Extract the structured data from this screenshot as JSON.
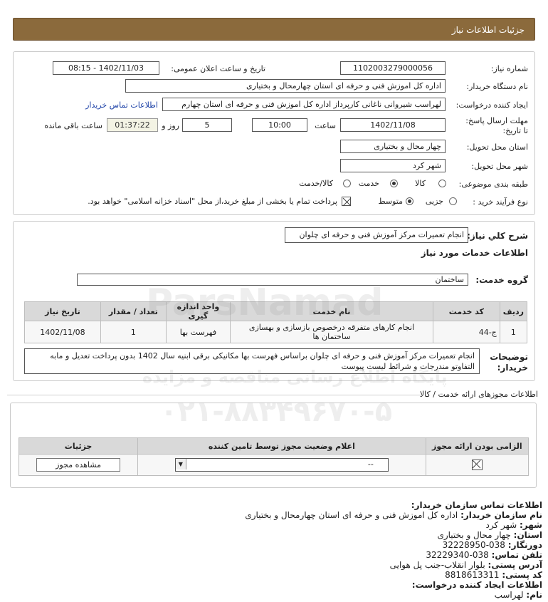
{
  "header": {
    "title": "جزئیات اطلاعات نیاز"
  },
  "details": {
    "need_number_label": "شماره نیاز:",
    "need_number": "1102003279000056",
    "announce_label": "تاریخ و ساعت اعلان عمومی:",
    "announce_value": "1402/11/03 - 08:15",
    "buyer_org_label": "نام دستگاه خریدار:",
    "buyer_org": "اداره کل اموزش فنی و حرفه ای استان چهارمحال و بختیاری",
    "creator_label": "ایجاد کننده درخواست:",
    "creator": "لهراسب شیروانی ناغانی کارپرداز اداره کل اموزش فنی و حرفه ای استان چهارم",
    "contact_link": "اطلاعات تماس خریدار",
    "deadline_label": "مهلت ارسال پاسخ: تا تاریخ:",
    "deadline_date": "1402/11/08",
    "time_label": "ساعت",
    "deadline_time": "10:00",
    "days_value": "5",
    "days_label": "روز و",
    "remaining_time": "01:37:22",
    "remaining_label": "ساعت باقی مانده",
    "province_label": "استان محل تحویل:",
    "province": "چهار محال و بختیاری",
    "city_label": "شهر محل تحویل:",
    "city": "شهر کرد",
    "category_label": "طبقه بندی موضوعی:",
    "category_options": [
      "کالا",
      "خدمت",
      "کالا/خدمت"
    ],
    "process_label": "نوع فرآیند خرید :",
    "process_options": [
      "جزیی",
      "متوسط"
    ],
    "payment_note": "پرداخت تمام یا بخشی از مبلغ خرید،از محل \"اسناد خزانه اسلامی\" خواهد بود."
  },
  "summary": {
    "label": "شرح كلي نياز:",
    "value": "انجام تعمیرات مرکز آموزش فنی و حرفه ای چلوان"
  },
  "services": {
    "title": "اطلاعات خدمات مورد نیاز",
    "group_label": "گروه خدمت:",
    "group_value": "ساختمان",
    "columns": [
      "ردیف",
      "کد خدمت",
      "نام خدمت",
      "واحد اندازه گیری",
      "تعداد / مقدار",
      "تاریخ نیاز"
    ],
    "rows": [
      {
        "row": "1",
        "code": "ج-44",
        "name": "انجام کارهای متفرقه درخصوص بازسازی و بهسازی ساختمان ها",
        "unit": "فهرست بها",
        "qty": "1",
        "date": "1402/11/08"
      }
    ],
    "buyer_notes_label": "توضیحات خریدار:",
    "buyer_notes": "انجام تعمیرات مرکز آموزش فنی و حرفه ای چلوان براساس فهرست بها مکانیکی برقی ابنیه سال 1402 بدون پرداخت تعدیل و مابه التفاوتو مندرجات و شرائط لیست پیوست"
  },
  "permits": {
    "title": "اطلاعات مجوزهای ارائه خدمت / کالا",
    "columns": [
      "الزامی بودن ارائه مجوز",
      "اعلام وضعیت مجوز توسط تامین کننده",
      "جزئیات"
    ],
    "select_value": "--",
    "view_button": "مشاهده مجوز"
  },
  "contact": {
    "title": "اطلاعات تماس سازمان خریدار:",
    "org_label": "نام سازمان خریدار:",
    "org": "اداره کل اموزش فنی و حرفه ای استان چهارمحال و بختیاری",
    "city_label": "شهر:",
    "city": "شهر کرد",
    "province_label": "استان:",
    "province": "چهار محال و بختیاری",
    "fax_label": "دورنگار:",
    "fax": "038-32228950",
    "phone_label": "تلفن تماس:",
    "phone": "038-32229340",
    "address_label": "آدرس پستی:",
    "address": "بلوار انقلاب-جنب پل هوایی",
    "postal_label": "کد پستی:",
    "postal": "8818613311",
    "creator_title": "اطلاعات ایجاد کننده درخواست:",
    "name_label": "نام:",
    "name": "لهراسب"
  },
  "watermark": {
    "brand": "ParsNamad",
    "text": "پایگاه اطلاع رسانی مناقصه و مزایده",
    "phone": "۰۲۱-۸۸۳۴۹۶۷۰-۵"
  }
}
